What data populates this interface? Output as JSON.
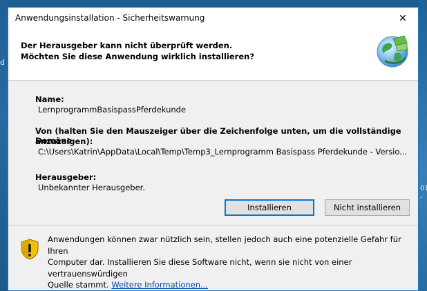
{
  "desktop": {
    "left_fragment": "d",
    "right_fragment_1": "01",
    "right_fragment_2": "-"
  },
  "window": {
    "title": "Anwendungsinstallation - Sicherheitswarnung",
    "close_glyph": "✕"
  },
  "header": {
    "line1": "Der Herausgeber kann nicht überprüft werden.",
    "line2": "Möchten Sie diese Anwendung wirklich installieren?"
  },
  "fields": {
    "name_label": "Name:",
    "name_value": "LernprogrammBasispassPferdekunde",
    "from_label_line1": "Von (halten Sie den Mauszeiger über die Zeichenfolge unten, um die vollständige Domäne",
    "from_label_line2": "anzuzeigen):",
    "from_value": "C:\\Users\\Katrin\\AppData\\Local\\Temp\\Temp3_Lernprogramm Basispass Pferdekunde - Versio...",
    "publisher_label": "Herausgeber:",
    "publisher_value": "Unbekannter Herausgeber."
  },
  "buttons": {
    "install": "Installieren",
    "no_install": "Nicht installieren"
  },
  "warning": {
    "line1": "Anwendungen können zwar nützlich sein, stellen jedoch auch eine potenzielle Gefahr für Ihren",
    "line2": "Computer dar. Installieren Sie diese Software nicht, wenn sie nicht von einer vertrauenswürdigen",
    "line3_prefix": "Quelle stammt. ",
    "link": "Weitere Informationen..."
  },
  "icons": {
    "header": "globe-installer-icon",
    "warning": "shield-warning-icon"
  },
  "colors": {
    "accent_border": "#1b78c8",
    "link": "#0645ad",
    "shield_yellow": "#f2c200"
  }
}
